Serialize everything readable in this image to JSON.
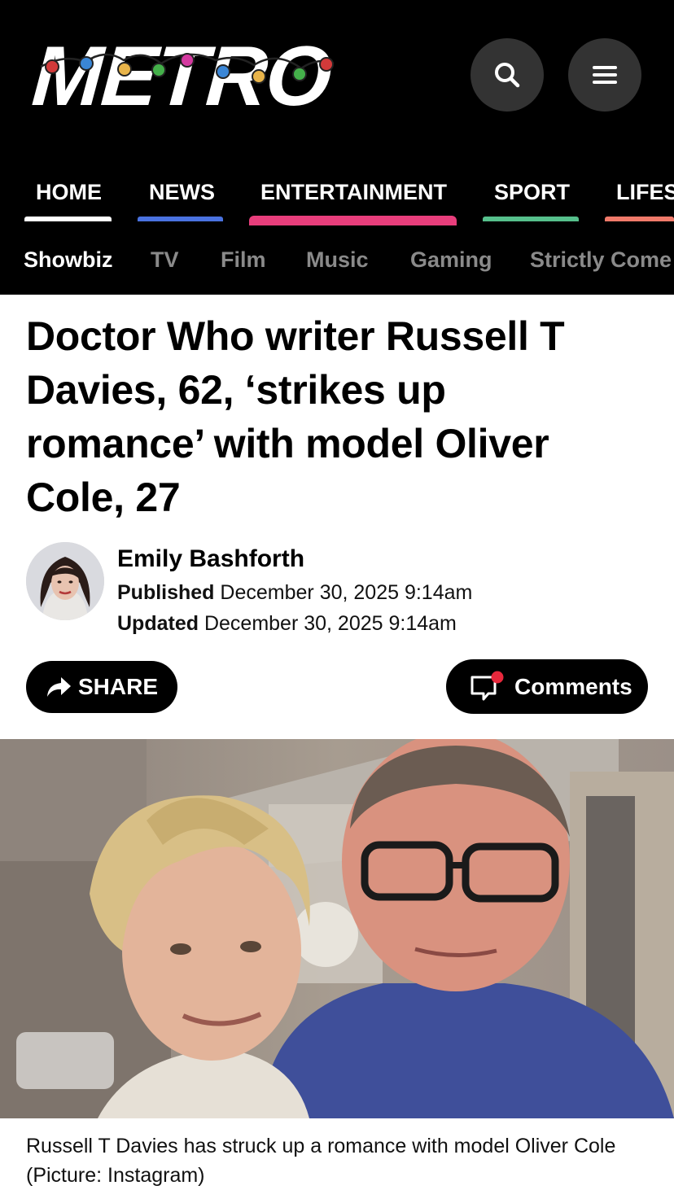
{
  "header": {
    "logo": "METRO",
    "search_icon": "search-icon",
    "menu_icon": "hamburger-menu-icon"
  },
  "nav": {
    "items": [
      {
        "label": "HOME",
        "color": "#ffffff"
      },
      {
        "label": "NEWS",
        "color": "#4a72e0"
      },
      {
        "label": "ENTERTAINMENT",
        "color": "#e83e7c"
      },
      {
        "label": "SPORT",
        "color": "#56c08c"
      },
      {
        "label": "LIFES",
        "color": "#f07a6a"
      }
    ]
  },
  "subnav": {
    "items": [
      {
        "label": "Showbiz",
        "active": true
      },
      {
        "label": "TV"
      },
      {
        "label": "Film"
      },
      {
        "label": "Music"
      },
      {
        "label": "Gaming"
      },
      {
        "label": "Strictly Come"
      }
    ]
  },
  "article": {
    "headline_lines": [
      "Doctor Who writer Russell T",
      "Davies, 62, ‘strikes up",
      "romance’ with model Oliver",
      "Cole, 27"
    ],
    "author": "Emily Bashforth",
    "published_label": "Published",
    "published_date": "December 30, 2025 9:14am",
    "updated_label": "Updated",
    "updated_date": "December 30, 2025 9:14am",
    "share_label": "SHARE",
    "comments_label": "Comments",
    "caption_line1": "Russell T Davies has struck up a romance with model Oliver Cole",
    "caption_line2": "(Picture: Instagram)"
  },
  "colors": {
    "header_bg": "#000000",
    "comments_dot": "#e8283c"
  }
}
